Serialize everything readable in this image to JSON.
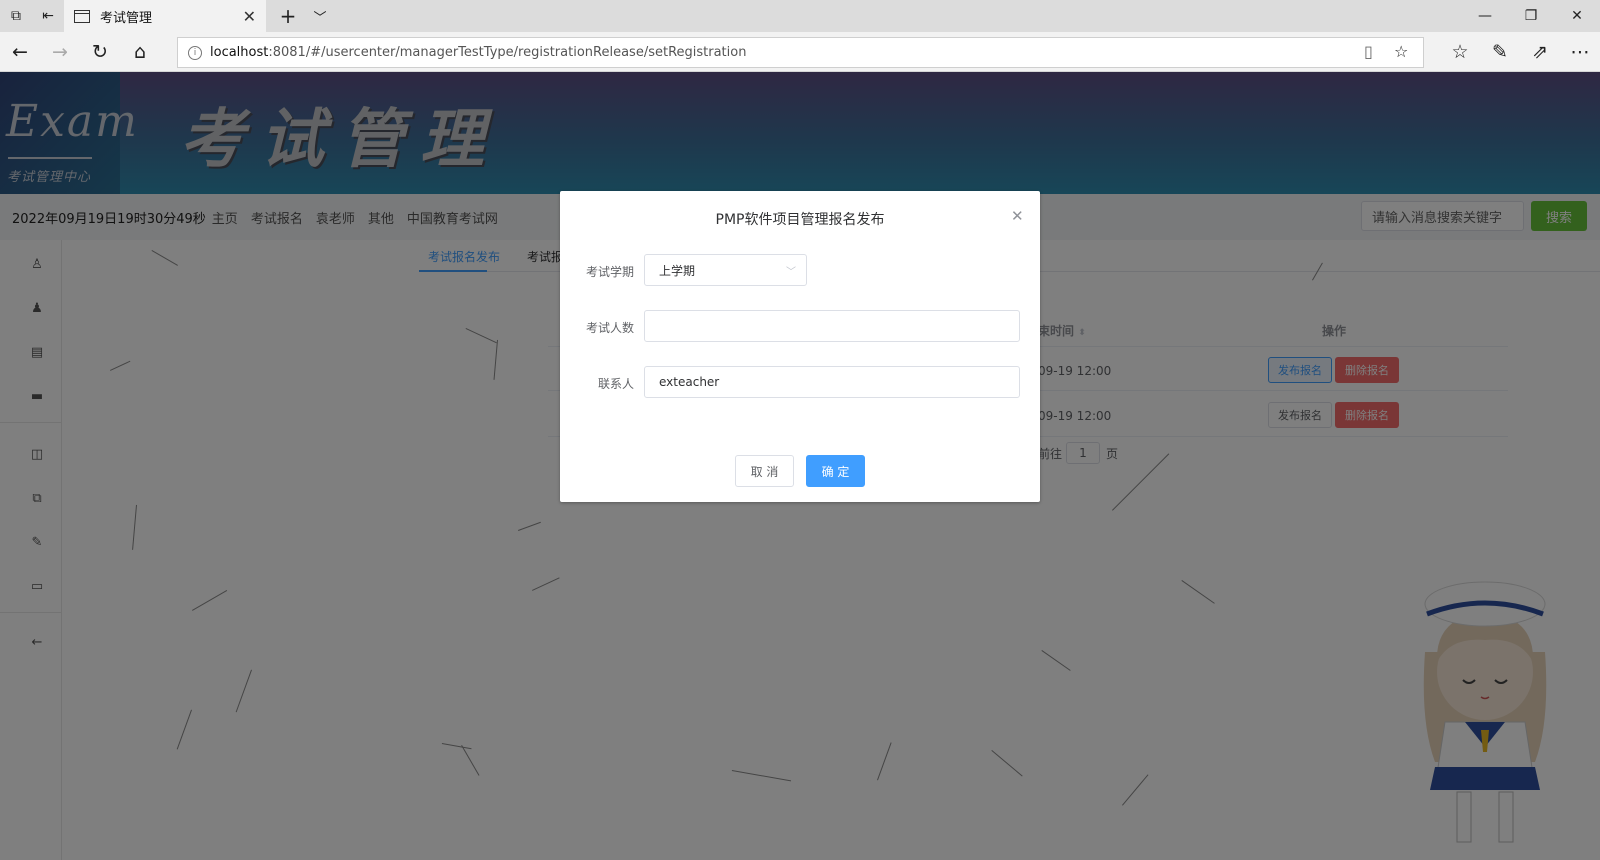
{
  "browser": {
    "tab_title": "考试管理",
    "url_host": "localhost",
    "url_rest": ":8081/#/usercenter/managerTestType/registrationRelease/setRegistration"
  },
  "banner": {
    "logo_text": "Exam",
    "logo_sub": "考试管理中心",
    "title": "考试管理"
  },
  "topnav": {
    "datetime": "2022年09月19日19时30分49秒",
    "links": [
      "主页",
      "考试报名",
      "袁老师",
      "其他",
      "中国教育考试网"
    ],
    "search_placeholder": "请输入消息搜索关键字",
    "search_button": "搜索"
  },
  "content": {
    "tabs": [
      "考试报名发布",
      "考试报"
    ],
    "columns": [
      "束时间",
      "操作"
    ],
    "rows": [
      {
        "end_time": "09-19 12:00",
        "publish": "发布报名",
        "delete": "删除报名"
      },
      {
        "end_time": "09-19 12:00",
        "publish": "发布报名",
        "delete": "删除报名"
      }
    ],
    "pager": {
      "goto": "前往",
      "page": "1",
      "suffix": "页"
    }
  },
  "dialog": {
    "title": "PMP软件项目管理报名发布",
    "fields": {
      "term_label": "考试学期",
      "term_value": "上学期",
      "count_label": "考试人数",
      "count_value": "",
      "contact_label": "联系人",
      "contact_value": "exteacher"
    },
    "cancel": "取 消",
    "confirm": "确 定"
  },
  "colors": {
    "primary": "#409eff",
    "success": "#67c23a",
    "danger": "#f56c6c"
  }
}
